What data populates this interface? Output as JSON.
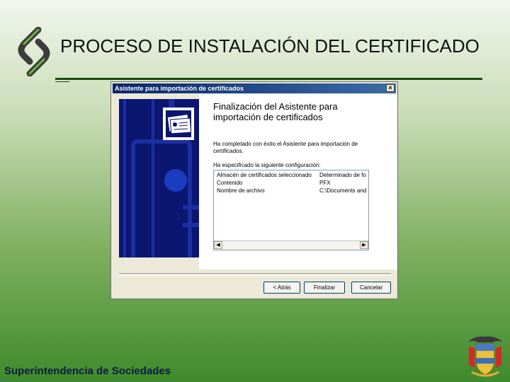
{
  "slide": {
    "title": "PROCESO DE INSTALACIÓN DEL CERTIFICADO",
    "footer": "Superintendencia de Sociedades"
  },
  "dialog": {
    "title": "Asistente para importación de certificados",
    "close_label": "×",
    "heading": "Finalización del Asistente para importación de certificados",
    "completed_text": "Ha completado con éxito el Asistente para importación de certificados.",
    "config_label": "Ha especificado la siguiente configuración:",
    "config_rows": [
      {
        "key": "Almacén de certificados seleccionado",
        "value": "Determinado de fo"
      },
      {
        "key": "Contenido",
        "value": "PFX"
      },
      {
        "key": "Nombre de archivo",
        "value": "C:\\Documents and"
      }
    ],
    "scroll_left": "◀",
    "scroll_right": "▶",
    "buttons": {
      "back": "< Atrás",
      "finish": "Finalizar",
      "cancel": "Cancelar"
    }
  },
  "colors": {
    "titlebar": "#0a246a",
    "side_panel": "#0b1670",
    "rule": "#1a4a10"
  }
}
